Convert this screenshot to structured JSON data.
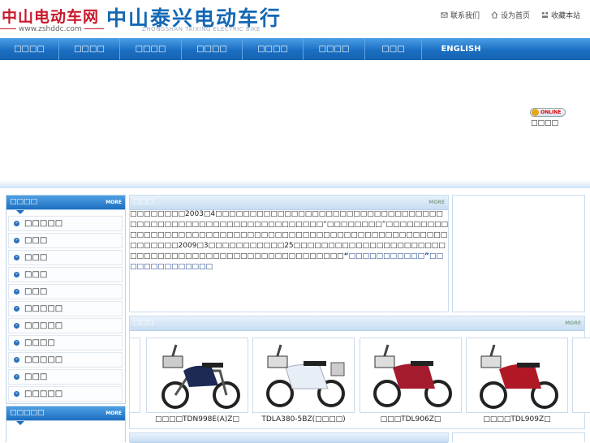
{
  "header": {
    "left_logo_cn": "中山电动车网",
    "left_logo_url": "www.zshddc.com",
    "main_logo_cn": "中山泰兴电动车行",
    "main_logo_en": "ZHONGSHAN TAIXING ELECTRIC BIKE",
    "links": [
      {
        "icon": "mail-icon",
        "label": "联系我们"
      },
      {
        "icon": "home-icon",
        "label": "设为首页"
      },
      {
        "icon": "favorites-icon",
        "label": "收藏本站"
      }
    ]
  },
  "nav": {
    "items": [
      "□□□□",
      "□□□□",
      "□□□□",
      "□□□□",
      "□□□□",
      "□□□□",
      "□□□",
      "ENGLISH"
    ]
  },
  "banner": {
    "online_badge": "ONLINE",
    "online_label": "□□□□"
  },
  "sidebar": {
    "categories_title": "□□□□",
    "categories_more": "MORE",
    "categories": [
      "□□□□□",
      "□□□",
      "□□□",
      "□□□",
      "□□□",
      "□□□□□",
      "□□□□□",
      "□□□□",
      "□□□□□",
      "□□□",
      "□□□□□"
    ],
    "second_title": "□□□□□",
    "second_more": "MORE"
  },
  "intro": {
    "title": "□□□",
    "more": "MORE",
    "text": "□□□□□□□□2003□4□□□□□□□□□□□□□□□□□□□□□□□□□□□□□□□□□□□□□□□□□□□□□□□□□□□□□□□□□□□□□“□□□□□□□□”□□□□□□□□□□□□□□□□□□□□□□□□□□□□□□□□□□□□□□□□□□□□□□□□□□□□□□□□□□□□□□2009□3□□□□□□□□□□□25□□□□□□□□□□□□□□□□□□□□□□□□□□□□□□□□□□□□□□□□□□□□□□□□□□□□□",
    "highlight": "“□□□□□□□□□□□”□□□□□□□□□□□□□□"
  },
  "products": {
    "title": "□□□",
    "more": "MORE",
    "items": [
      {
        "label": "□□□□TDN998E(A)Z□",
        "color": "#1c2a55"
      },
      {
        "label": "TDLA380-5BZ(□□□□)",
        "color": "#e8eef5"
      },
      {
        "label": "□□□TDL906Z□",
        "color": "#a31b2c"
      },
      {
        "label": "□□□□TDL909Z□",
        "color": "#b01826"
      }
    ]
  }
}
